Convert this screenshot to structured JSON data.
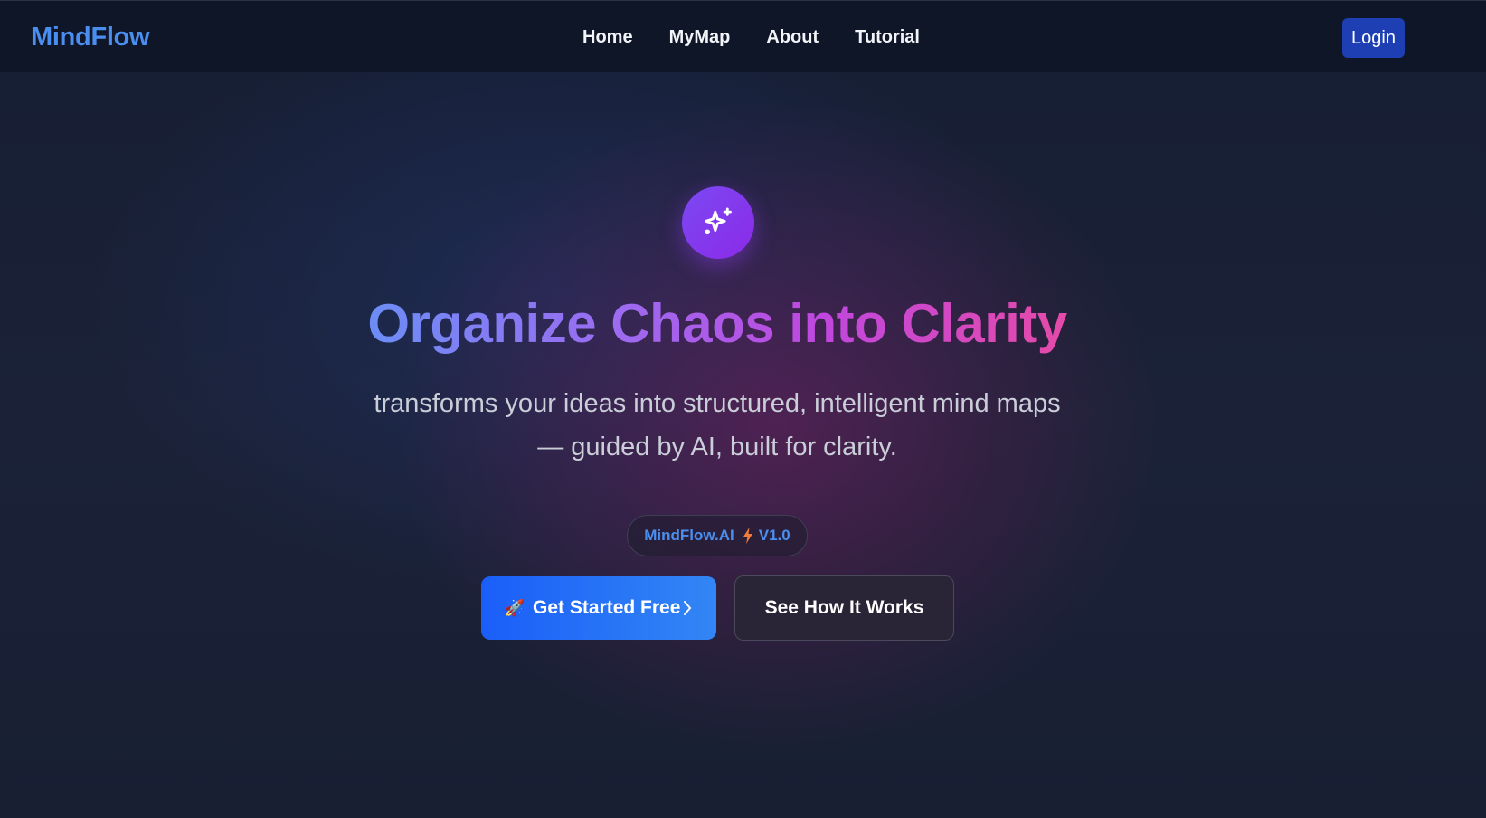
{
  "nav": {
    "brand": "MindFlow",
    "links": [
      "Home",
      "MyMap",
      "About",
      "Tutorial"
    ],
    "login_label": "Login"
  },
  "hero": {
    "icon": "sparkles-icon",
    "headline": "Organize Chaos into Clarity",
    "subtitle_line1": "transforms your ideas into structured, intelligent mind maps",
    "subtitle_line2": "— guided by AI, built for clarity.",
    "pill": {
      "product": "MindFlow.AI",
      "icon": "lightning-bolt-icon",
      "version": "V1.0"
    },
    "primary_cta": {
      "icon": "rocket-icon",
      "label": "Get Started Free",
      "trailing_icon": "chevron-right-icon"
    },
    "secondary_cta": {
      "label": "See How It Works"
    }
  },
  "colors": {
    "brand_blue": "#4a8ef0",
    "login_bg": "#1d3fb3",
    "headline_gradient": [
      "#6c8df6",
      "#9b6cf1",
      "#c047de",
      "#e54aa8"
    ],
    "primary_cta_gradient": [
      "#1a5ef8",
      "#3386f5"
    ],
    "icon_badge": "#8c2ae8",
    "bolt": "#f07b3a"
  }
}
